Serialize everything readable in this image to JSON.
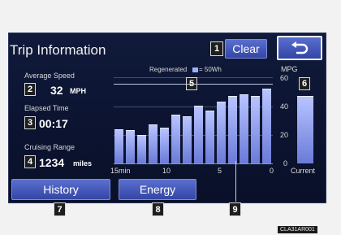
{
  "header": {
    "title": "Trip Information",
    "clear_label": "Clear",
    "back_icon": "back-arrow-icon"
  },
  "stats": {
    "avg_speed_label": "Average Speed",
    "avg_speed_value": "32",
    "avg_speed_unit": "MPH",
    "elapsed_label": "Elapsed Time",
    "elapsed_value": "00:17",
    "range_label": "Cruising Range",
    "range_value": "1234",
    "range_unit": "miles"
  },
  "legend": {
    "regenerated": "Regenerated",
    "per": "= 50Wh"
  },
  "chart": {
    "y_unit": "MPG",
    "y_ticks": [
      "60",
      "40",
      "20",
      "0"
    ],
    "x_ticks": [
      "15min",
      "10",
      "5",
      "0"
    ],
    "current_label": "Current"
  },
  "chart_data": {
    "type": "bar",
    "ylabel": "MPG",
    "ylim": [
      0,
      60
    ],
    "x_ticks": [
      "15min",
      "10",
      "5",
      "0"
    ],
    "values": [
      24,
      23,
      20,
      27,
      25,
      34,
      33,
      40,
      37,
      43,
      47,
      48,
      47,
      52
    ],
    "current": {
      "label": "Current",
      "value": 47
    }
  },
  "footer": {
    "history_label": "History",
    "energy_label": "Energy"
  },
  "markers": [
    "1",
    "2",
    "3",
    "4",
    "5",
    "6",
    "7",
    "8",
    "9"
  ],
  "corner_code": "CLA31AR001"
}
